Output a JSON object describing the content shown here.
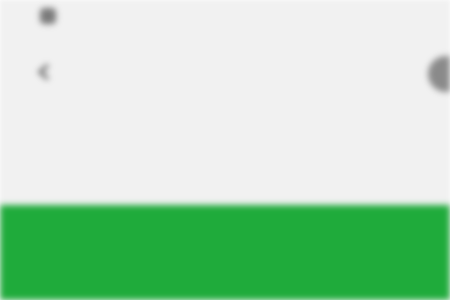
{
  "status_bar": {
    "time": "",
    "icons": "",
    "app_icon": "app-icon"
  },
  "header": {
    "back_icon": "back-arrow-icon",
    "title": "",
    "subtitle": "",
    "right_icon": "profile-circle-icon"
  },
  "action_panel": {
    "label": "",
    "color": "#1fab3b"
  }
}
